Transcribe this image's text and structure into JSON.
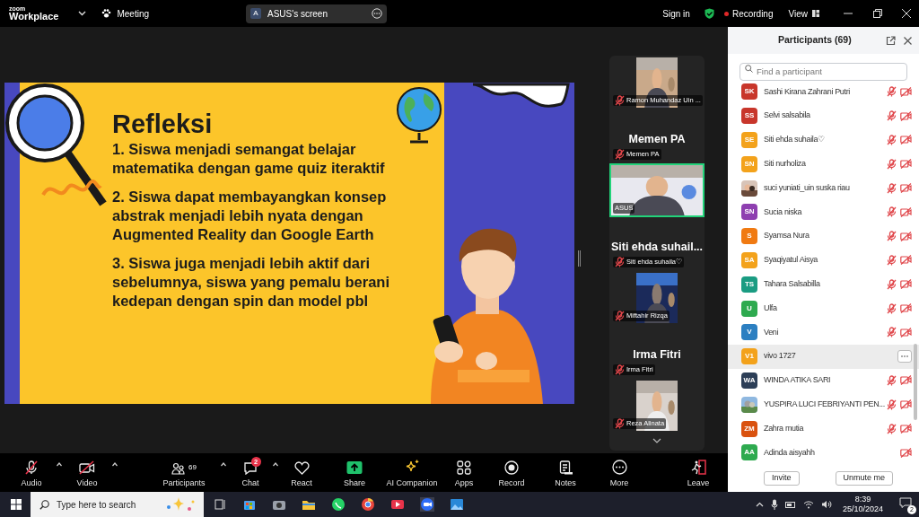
{
  "top_bar": {
    "logo_top": "zoom",
    "logo_bottom": "Workplace",
    "meeting_menu": "Meeting",
    "share_pill": {
      "avatar": "A",
      "label": "ASUS's screen"
    },
    "sign_in": "Sign in",
    "recording": "Recording",
    "view": "View"
  },
  "slide": {
    "title": "Refleksi",
    "points": [
      "1. Siswa menjadi semangat belajar matematika dengan game quiz iteraktif",
      "2. Siswa dapat membayangkan konsep abstrak menjadi lebih nyata dengan Augmented Reality dan Google Earth",
      "3. Siswa juga menjadi lebih aktif dari sebelumnya, siswa yang pemalu berani kedepan dengan spin dan model pbl"
    ]
  },
  "video_tiles": [
    {
      "kind": "video",
      "label": "Ramon Muhandaz Uin ...",
      "muted": true,
      "speaking": false
    },
    {
      "kind": "name",
      "display_name": "Memen PA",
      "label": "Memen PA",
      "muted": true,
      "speaking": false
    },
    {
      "kind": "video",
      "label": "ASUS",
      "muted": false,
      "speaking": true
    },
    {
      "kind": "name",
      "display_name": "Siti  ehda  suhail...",
      "label": "Siti ehda suhaila♡",
      "muted": true,
      "speaking": false
    },
    {
      "kind": "video",
      "label": "Miftahir Rizqa",
      "muted": true,
      "speaking": false
    },
    {
      "kind": "name",
      "display_name": "Irma Fitri",
      "label": "Irma Fitri",
      "muted": true,
      "speaking": false
    },
    {
      "kind": "video",
      "label": "Reza Alinata",
      "muted": true,
      "speaking": false
    }
  ],
  "participants_panel": {
    "title": "Participants (69)",
    "search": {
      "placeholder": "Find a participant"
    },
    "items": [
      {
        "kind": "initials",
        "initials": "SK",
        "color": "#c8362b",
        "name": "Sashi Kirana Zahrani Putri",
        "mic_muted": true,
        "video_off": true,
        "selected": false
      },
      {
        "kind": "initials",
        "initials": "SS",
        "color": "#c8362b",
        "name": "Selvi salsabila",
        "mic_muted": true,
        "video_off": true,
        "selected": false
      },
      {
        "kind": "initials",
        "initials": "SE",
        "color": "#f3a21b",
        "name": "Siti ehda suhaila♡",
        "mic_muted": true,
        "video_off": true,
        "selected": false
      },
      {
        "kind": "initials",
        "initials": "SN",
        "color": "#f3a21b",
        "name": "Siti nurholiza",
        "mic_muted": true,
        "video_off": true,
        "selected": false
      },
      {
        "name": "suci yuniati_uin suska riau",
        "mic_muted": true,
        "video_off": true,
        "selected": false
      },
      {
        "kind": "initials",
        "initials": "SN",
        "color": "#8e3fb0",
        "name": "Sucia niska",
        "mic_muted": true,
        "video_off": true,
        "selected": false
      },
      {
        "kind": "initials",
        "initials": "S",
        "color": "#f07a12",
        "name": "Syamsa Nura",
        "mic_muted": true,
        "video_off": true,
        "selected": false
      },
      {
        "kind": "initials",
        "initials": "SA",
        "color": "#f3a21b",
        "name": "Syaqiyatul Aisya",
        "mic_muted": true,
        "video_off": true,
        "selected": false
      },
      {
        "kind": "initials",
        "initials": "TS",
        "color": "#1a9c82",
        "name": "Tahara Salsabilla",
        "mic_muted": true,
        "video_off": true,
        "selected": false
      },
      {
        "kind": "initials",
        "initials": "U",
        "color": "#2eaa4f",
        "name": "Ulfa",
        "mic_muted": true,
        "video_off": true,
        "selected": false
      },
      {
        "kind": "initials",
        "initials": "V",
        "color": "#2c7fc1",
        "name": "Veni",
        "mic_muted": true,
        "video_off": true,
        "selected": false
      },
      {
        "kind": "initials",
        "initials": "V1",
        "color": "#f3a21b",
        "name": "vivo 1727",
        "mic_muted": false,
        "video_off": false,
        "selected": true
      },
      {
        "kind": "initials",
        "initials": "WA",
        "color": "#2c3e57",
        "name": "WINDA ATIKA SARI",
        "mic_muted": true,
        "video_off": true,
        "selected": false
      },
      {
        "name": "YUSPIRA LUCI FEBRIYANTI PEN...",
        "mic_muted": true,
        "video_off": true,
        "selected": false
      },
      {
        "kind": "initials",
        "initials": "ZM",
        "color": "#d9520f",
        "name": "Zahra mutia",
        "mic_muted": true,
        "video_off": true,
        "selected": false
      },
      {
        "kind": "initials",
        "initials": "AA",
        "color": "#2eaa4f",
        "name": "Adinda aisyahh",
        "mic_muted": false,
        "video_off": true,
        "selected": false
      }
    ],
    "buttons": [
      "Invite",
      "Unmute me"
    ]
  },
  "toolbar": [
    {
      "kind": "audio",
      "label": "Audio",
      "off": true,
      "caret": true
    },
    {
      "kind": "video",
      "label": "Video",
      "off": true,
      "caret": true
    },
    {
      "kind": "participants",
      "label": "Participants",
      "count": "69",
      "caret": true
    },
    {
      "kind": "chat",
      "label": "Chat",
      "badge": "2",
      "caret": true
    },
    {
      "kind": "react",
      "label": "React",
      "caret": false
    },
    {
      "kind": "share",
      "label": "Share",
      "caret": false
    },
    {
      "kind": "ai",
      "label": "AI Companion",
      "caret": false
    },
    {
      "kind": "apps",
      "label": "Apps",
      "caret": false
    },
    {
      "kind": "record",
      "label": "Record",
      "caret": false
    },
    {
      "kind": "notes",
      "label": "Notes",
      "caret": false
    },
    {
      "kind": "more",
      "label": "More",
      "caret": false
    },
    {
      "kind": "leave",
      "label": "Leave",
      "caret": false
    }
  ],
  "taskbar": {
    "search": {
      "placeholder": "Type here to search"
    },
    "time": "8:39",
    "date": "25/10/2024",
    "notifications": "2"
  }
}
